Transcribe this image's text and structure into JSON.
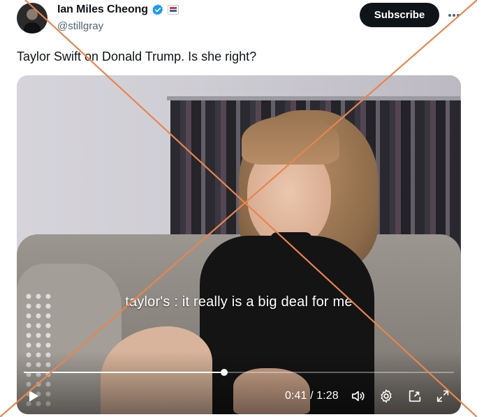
{
  "author": {
    "display_name": "Ian Miles Cheong",
    "handle": "@stillgray"
  },
  "actions": {
    "subscribe_label": "Subscribe"
  },
  "tweet": {
    "text": "Taylor Swift on Donald Trump. Is she right?"
  },
  "video": {
    "caption": "taylor's : it really is a big deal for me",
    "time_display": "0:41 / 1:28",
    "progress_fraction": 0.466
  },
  "icons": {
    "verified": "verified-badge-icon",
    "affiliation": "affiliation-flag-icon",
    "more": "more-options-icon",
    "play": "play-icon",
    "volume": "volume-icon",
    "settings": "settings-gear-icon",
    "pip": "picture-in-picture-icon",
    "fullscreen": "fullscreen-icon",
    "overlay": "cross-out-overlay"
  },
  "colors": {
    "subscribe_bg": "#0f1419",
    "verified_blue": "#1d9bf0",
    "handle_gray": "#536471",
    "overlay_orange": "#e8854f"
  }
}
